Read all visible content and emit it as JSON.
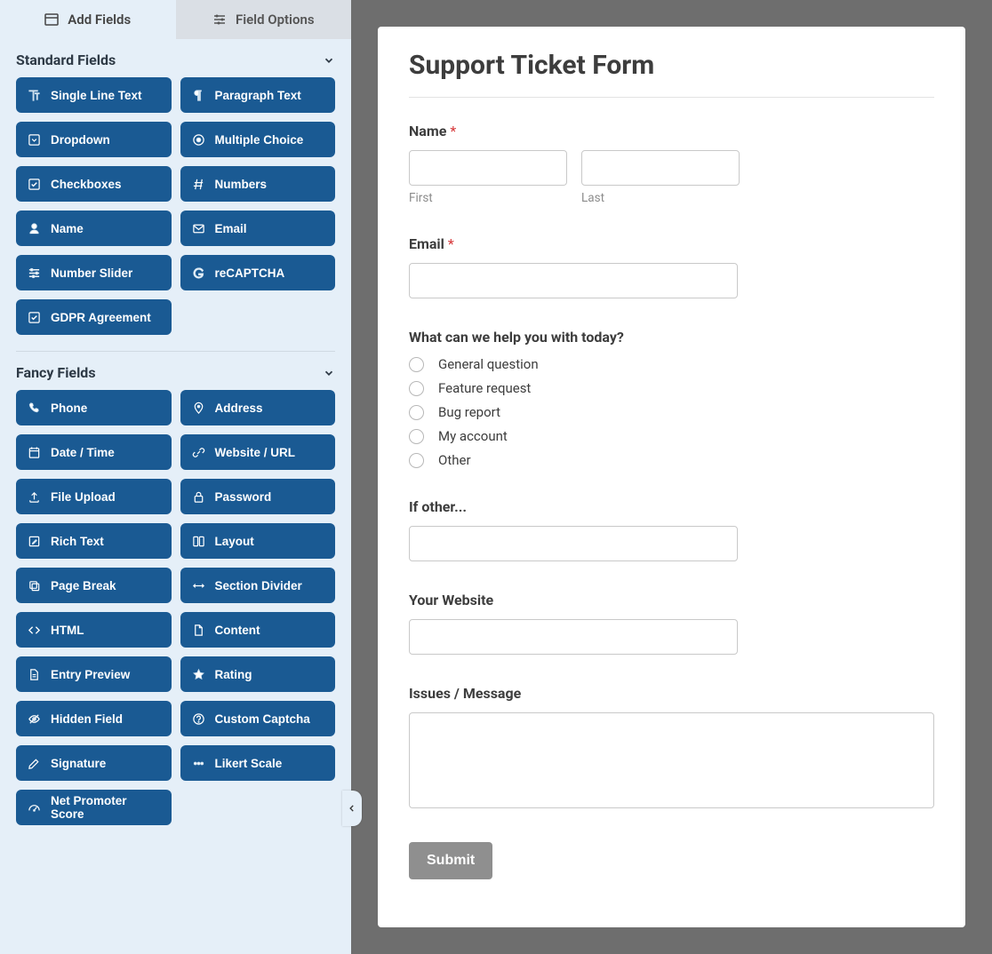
{
  "tabs": {
    "add_fields": "Add Fields",
    "field_options": "Field Options"
  },
  "sections": {
    "standard": {
      "title": "Standard Fields",
      "fields": [
        {
          "label": "Single Line Text",
          "icon": "text-type"
        },
        {
          "label": "Paragraph Text",
          "icon": "pilcrow"
        },
        {
          "label": "Dropdown",
          "icon": "caret-square"
        },
        {
          "label": "Multiple Choice",
          "icon": "radio-dot"
        },
        {
          "label": "Checkboxes",
          "icon": "check-square"
        },
        {
          "label": "Numbers",
          "icon": "hash"
        },
        {
          "label": "Name",
          "icon": "user"
        },
        {
          "label": "Email",
          "icon": "envelope"
        },
        {
          "label": "Number Slider",
          "icon": "sliders"
        },
        {
          "label": "reCAPTCHA",
          "icon": "google-g"
        },
        {
          "label": "GDPR Agreement",
          "icon": "check-square"
        }
      ]
    },
    "fancy": {
      "title": "Fancy Fields",
      "fields": [
        {
          "label": "Phone",
          "icon": "phone"
        },
        {
          "label": "Address",
          "icon": "map-pin"
        },
        {
          "label": "Date / Time",
          "icon": "calendar"
        },
        {
          "label": "Website / URL",
          "icon": "link"
        },
        {
          "label": "File Upload",
          "icon": "upload"
        },
        {
          "label": "Password",
          "icon": "lock"
        },
        {
          "label": "Rich Text",
          "icon": "edit-square"
        },
        {
          "label": "Layout",
          "icon": "columns"
        },
        {
          "label": "Page Break",
          "icon": "copy"
        },
        {
          "label": "Section Divider",
          "icon": "arrows-h"
        },
        {
          "label": "HTML",
          "icon": "code"
        },
        {
          "label": "Content",
          "icon": "file"
        },
        {
          "label": "Entry Preview",
          "icon": "file-lines"
        },
        {
          "label": "Rating",
          "icon": "star"
        },
        {
          "label": "Hidden Field",
          "icon": "eye-slash"
        },
        {
          "label": "Custom Captcha",
          "icon": "question-circle"
        },
        {
          "label": "Signature",
          "icon": "pencil"
        },
        {
          "label": "Likert Scale",
          "icon": "dots"
        },
        {
          "label": "Net Promoter Score",
          "icon": "tachometer"
        }
      ]
    }
  },
  "form": {
    "title": "Support Ticket Form",
    "name": {
      "label": "Name",
      "first_sub": "First",
      "last_sub": "Last"
    },
    "email": {
      "label": "Email"
    },
    "help": {
      "label": "What can we help you with today?",
      "options": [
        "General question",
        "Feature request",
        "Bug report",
        "My account",
        "Other"
      ]
    },
    "other": {
      "label": "If other..."
    },
    "website": {
      "label": "Your Website"
    },
    "message": {
      "label": "Issues / Message"
    },
    "submit": "Submit"
  }
}
